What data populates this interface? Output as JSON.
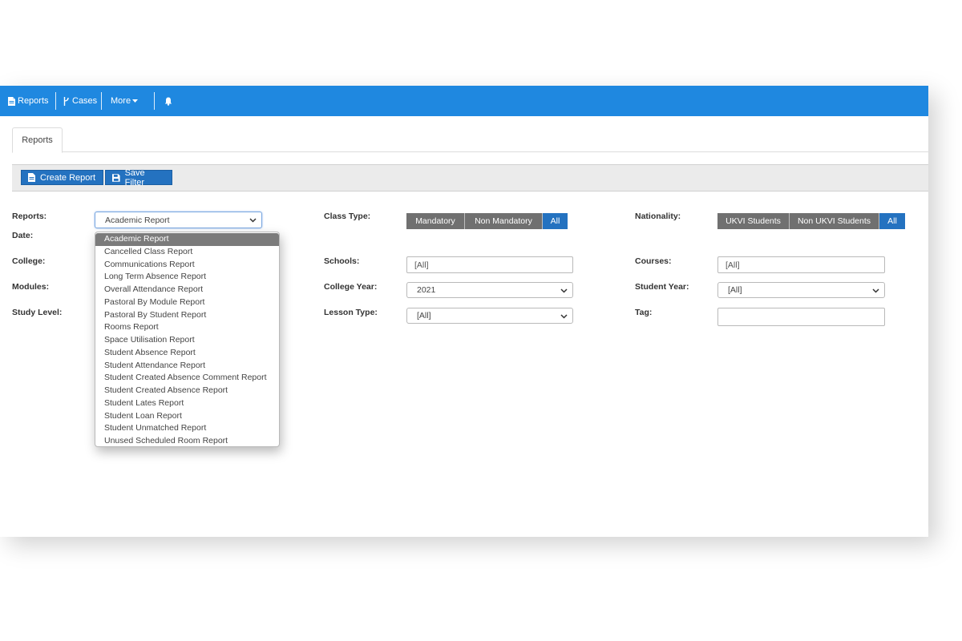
{
  "navbar": {
    "items": [
      {
        "label": "Reports",
        "icon": "file-icon"
      },
      {
        "label": "Cases",
        "icon": "branch-icon"
      },
      {
        "label": "More",
        "icon": "caret-down-icon"
      }
    ],
    "notification_icon": "bell-icon"
  },
  "tabs": [
    {
      "label": "Reports"
    }
  ],
  "toolbar": {
    "create_report_label": "Create Report",
    "save_filter_label": "Save Filter"
  },
  "filters": {
    "reports": {
      "label": "Reports:",
      "value": "Academic Report"
    },
    "date": {
      "label": "Date:"
    },
    "college": {
      "label": "College:"
    },
    "modules": {
      "label": "Modules:"
    },
    "study_level": {
      "label": "Study Level:"
    },
    "class_type": {
      "label": "Class Type:",
      "options": [
        "Mandatory",
        "Non Mandatory",
        "All"
      ],
      "active": "All"
    },
    "schools": {
      "label": "Schools:",
      "value": "[All]"
    },
    "college_year": {
      "label": "College Year:",
      "value": "2021"
    },
    "lesson_type": {
      "label": "Lesson Type:",
      "value": "[All]"
    },
    "nationality": {
      "label": "Nationality:",
      "options": [
        "UKVI Students",
        "Non UKVI Students",
        "All"
      ],
      "active": "All"
    },
    "courses": {
      "label": "Courses:",
      "value": "[All]"
    },
    "student_year": {
      "label": "Student Year:",
      "value": "[All]"
    },
    "tag": {
      "label": "Tag:",
      "value": ""
    }
  },
  "report_dropdown": {
    "selected": "Academic Report",
    "options": [
      "Academic Report",
      "Cancelled Class Report",
      "Communications Report",
      "Long Term Absence Report",
      "Overall Attendance Report",
      "Pastoral By Module Report",
      "Pastoral By Student Report",
      "Rooms Report",
      "Space Utilisation Report",
      "Student Absence Report",
      "Student Attendance Report",
      "Student Created Absence Comment Report",
      "Student Created Absence Report",
      "Student Lates Report",
      "Student Loan Report",
      "Student Unmatched Report",
      "Unused Scheduled Room Report"
    ]
  },
  "colors": {
    "navbar": "#1f88e0",
    "primary_button": "#2472c0",
    "segment_inactive": "#707070",
    "dropdown_selected": "#7b7b7b"
  }
}
